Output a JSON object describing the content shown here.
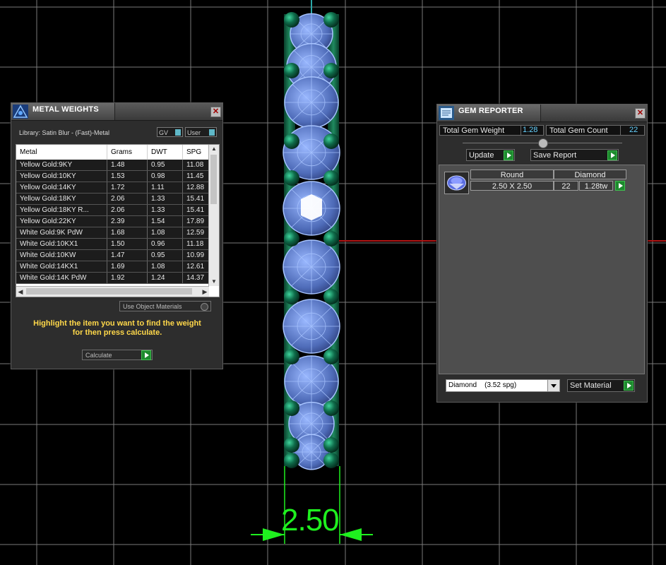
{
  "viewport": {
    "dimension_label": "2.50"
  },
  "metal_weights": {
    "title": "METAL WEIGHTS",
    "library_label": "Library: Satin Blur - (Fast)-Metal",
    "toggle_gv": "GV",
    "toggle_user": "User",
    "columns": [
      "Metal",
      "Grams",
      "DWT",
      "SPG"
    ],
    "rows": [
      [
        "Yellow Gold:9KY",
        "1.48",
        "0.95",
        "11.08"
      ],
      [
        "Yellow Gold:10KY",
        "1.53",
        "0.98",
        "11.45"
      ],
      [
        "Yellow Gold:14KY",
        "1.72",
        "1.11",
        "12.88"
      ],
      [
        "Yellow Gold:18KY",
        "2.06",
        "1.33",
        "15.41"
      ],
      [
        "Yellow Gold:18KY R...",
        "2.06",
        "1.33",
        "15.41"
      ],
      [
        "Yellow Gold:22KY",
        "2.39",
        "1.54",
        "17.89"
      ],
      [
        "White Gold:9K PdW",
        "1.68",
        "1.08",
        "12.59"
      ],
      [
        "White Gold:10KX1",
        "1.50",
        "0.96",
        "11.18"
      ],
      [
        "White Gold:10KW",
        "1.47",
        "0.95",
        "10.99"
      ],
      [
        "White Gold:14KX1",
        "1.69",
        "1.08",
        "12.61"
      ],
      [
        "White Gold:14K PdW",
        "1.92",
        "1.24",
        "14.37"
      ]
    ],
    "use_object_materials": "Use Object Materials",
    "hint_line1": "Highlight the item you want to find the weight",
    "hint_line2": "for then press calculate.",
    "calculate_label": "Calculate"
  },
  "gem_reporter": {
    "title": "GEM REPORTER",
    "total_weight_label": "Total Gem Weight",
    "total_weight_value": "1.28",
    "total_count_label": "Total Gem Count",
    "total_count_value": "22",
    "update_label": "Update",
    "save_report_label": "Save Report",
    "gem": {
      "shape": "Round",
      "material": "Diamond",
      "size": "2.50 X 2.50",
      "count": "22",
      "weight": "1.28tw"
    },
    "material_select": "Diamond    (3.52 spg)",
    "set_material_label": "Set Material"
  },
  "colors": {
    "background": "#000000",
    "grid": "#8a8a8a",
    "gem_wire": "#8fb4ff",
    "prong": "#0f6b4a",
    "dimension": "#1ff01f",
    "axis_red": "#b21414",
    "value_blue": "#66d2ff",
    "hint_yellow": "#ffd84a"
  }
}
